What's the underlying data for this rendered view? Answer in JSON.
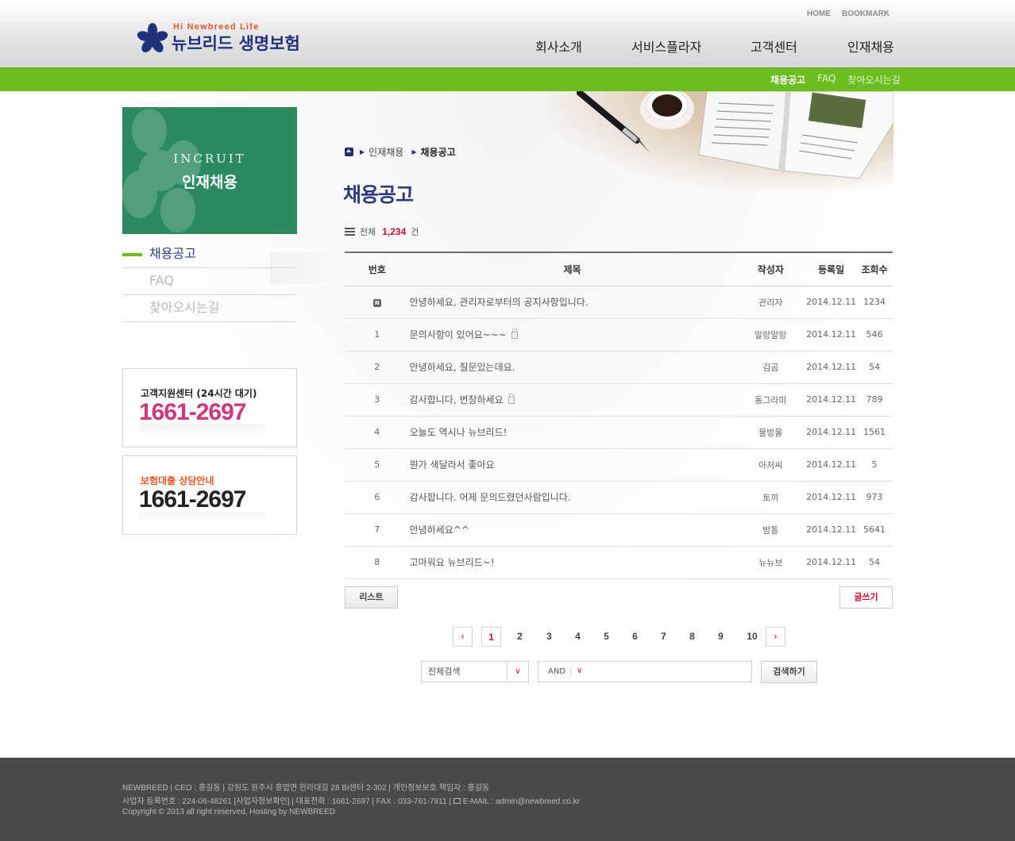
{
  "header": {
    "tagline": "Hi Newbreed Life",
    "brand": "뉴브리드 생명보험",
    "util_nav": [
      "HOME",
      "BOOKMARK"
    ],
    "gnb": [
      "회사소개",
      "서비스플라자",
      "고객센터",
      "인재채용"
    ]
  },
  "sub_nav": {
    "items": [
      "채용공고",
      "FAQ",
      "찾아오시는길"
    ],
    "active_index": 0
  },
  "sidebar": {
    "banner_en": "INCRUIT",
    "banner_ko": "인재채용",
    "menu": [
      "채용공고",
      "FAQ",
      "찾아오시는길"
    ],
    "active_index": 0,
    "support": {
      "label": "고객지원센터 (24시간 대기)",
      "phone": "1661-2697",
      "label_color": "#222222",
      "phone_color": "#d0367a"
    },
    "loan": {
      "label": "보험대출 상담안내",
      "phone": "1661-2697",
      "label_color": "#e2582a",
      "phone_color": "#222222"
    }
  },
  "breadcrumb": [
    "인재채용",
    "채용공고"
  ],
  "page_title": "채용공고",
  "total": {
    "label": "전체",
    "count": "1,234",
    "unit": "건"
  },
  "board": {
    "columns": [
      "번호",
      "제목",
      "작성자",
      "등록일",
      "조회수"
    ],
    "rows": [
      {
        "no": "N",
        "notice": true,
        "title": "안녕하세요, 관리자로부터의 공지사항입니다.",
        "locked": false,
        "author": "관리자",
        "date": "2014.12.11",
        "views": "1234"
      },
      {
        "no": "1",
        "notice": false,
        "title": "문의사항이 있어요~~~",
        "locked": true,
        "author": "말랑말랑",
        "date": "2014.12.11",
        "views": "546"
      },
      {
        "no": "2",
        "notice": false,
        "title": "안녕하세요, 질문있는데요.",
        "locked": false,
        "author": "김곰",
        "date": "2014.12.11",
        "views": "54"
      },
      {
        "no": "3",
        "notice": false,
        "title": "감사합니다, 번창하세요",
        "locked": true,
        "author": "동그라미",
        "date": "2014.12.11",
        "views": "789"
      },
      {
        "no": "4",
        "notice": false,
        "title": "오늘도 역시나 뉴브리드!",
        "locked": false,
        "author": "물방울",
        "date": "2014.12.11",
        "views": "1561"
      },
      {
        "no": "5",
        "notice": false,
        "title": "뭔가 색달라서 좋아요",
        "locked": false,
        "author": "아저씨",
        "date": "2014.12.11",
        "views": "5"
      },
      {
        "no": "6",
        "notice": false,
        "title": "감사합니다. 어제 문의드렸던사람입니다.",
        "locked": false,
        "author": "토끼",
        "date": "2014.12.11",
        "views": "973"
      },
      {
        "no": "7",
        "notice": false,
        "title": "안녕하세요^^",
        "locked": false,
        "author": "밤톨",
        "date": "2014.12.11",
        "views": "5641"
      },
      {
        "no": "8",
        "notice": false,
        "title": "고마워요 뉴브리드~!",
        "locked": false,
        "author": "뉴뉴브",
        "date": "2014.12.11",
        "views": "54"
      }
    ]
  },
  "buttons": {
    "list": "리스트",
    "write": "글쓰기",
    "search": "검색하기"
  },
  "pagination": {
    "pages": [
      "1",
      "2",
      "3",
      "4",
      "5",
      "6",
      "7",
      "8",
      "9",
      "10"
    ],
    "current": "1",
    "prev_icon": "chevron-left-icon",
    "next_icon": "chevron-right-icon"
  },
  "search": {
    "scope": "전체검색",
    "operator": "AND",
    "query": ""
  },
  "footer": {
    "line1": "NEWBREED | CEO : 홍길동 | 강원도 원주시 흥업면 한라대길 28 BI센터 2-302 | 개인정보보호 책임자 : 홍길동",
    "line2a": "사업자 등록번호 : 224-06-48261 [사업자정보확인] | 대표전화 : 1661-2697 | FAX : 033-761-7811 | ",
    "line2b": "E-MAIL : admin@newbreed.co.kr",
    "line3": "Copyright © 2013 all right reserved, Hosting by NEWBREED"
  },
  "colors": {
    "accent_green": "#6bbd22",
    "brand_navy": "#21317b",
    "title_navy": "#2f3a7e",
    "accent_red": "#c8102e",
    "banner_green": "#2b8a5f",
    "footer_bg": "#4a4a4a"
  }
}
